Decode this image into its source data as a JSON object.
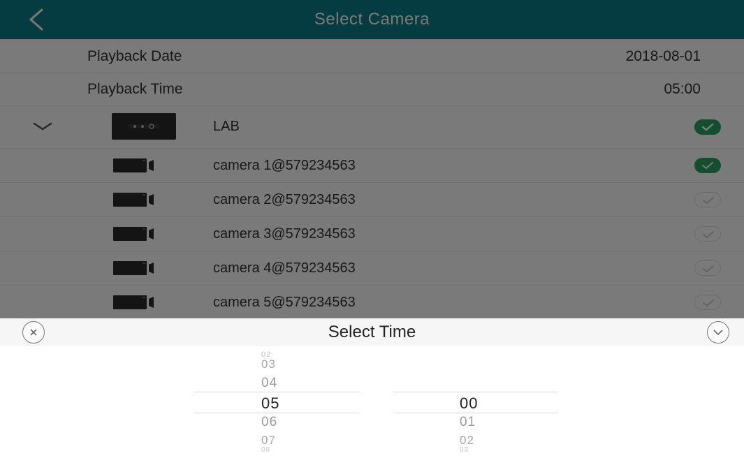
{
  "header": {
    "title": "Select Camera",
    "back_icon": "chevron-left-icon"
  },
  "playback": {
    "date_label": "Playback Date",
    "date_value": "2018-08-01",
    "time_label": "Playback Time",
    "time_value": "05:00"
  },
  "device": {
    "name": "LAB",
    "selected": true
  },
  "cameras": [
    {
      "name": "camera 1@579234563",
      "selected": true
    },
    {
      "name": "camera 2@579234563",
      "selected": false
    },
    {
      "name": "camera 3@579234563",
      "selected": false
    },
    {
      "name": "camera 4@579234563",
      "selected": false
    },
    {
      "name": "camera 5@579234563",
      "selected": false
    }
  ],
  "picker": {
    "title": "Select Time",
    "cancel_icon": "close-circle-icon",
    "confirm_icon": "check-circle-icon",
    "hours": [
      "02",
      "03",
      "04",
      "05",
      "06",
      "07",
      "08"
    ],
    "selected_hour": "05",
    "minutes": [
      "00",
      "01",
      "02",
      "03"
    ],
    "selected_minute": "00"
  },
  "colors": {
    "header_bg": "#0b7d88",
    "check_on": "#26a363"
  }
}
